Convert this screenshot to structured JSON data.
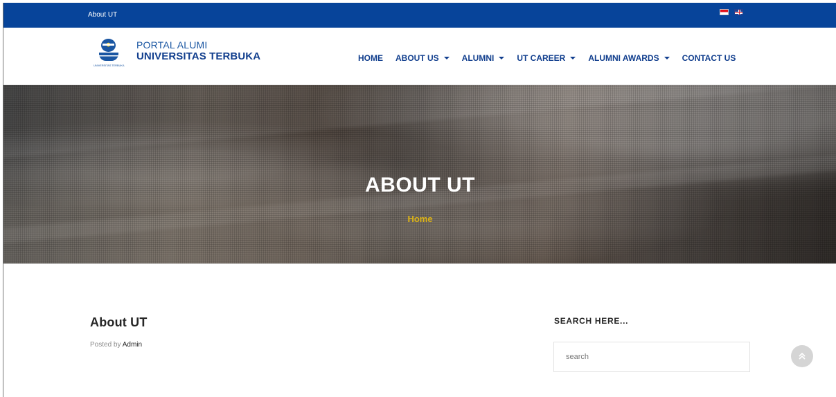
{
  "topbar": {
    "title": "About UT",
    "flags": [
      {
        "icon": "indonesia-flag-icon"
      },
      {
        "icon": "united-kingdom-flag-icon"
      }
    ]
  },
  "logo": {
    "line1": "PORTAL ALUMI",
    "line2": "UNIVERSITAS TERBUKA",
    "mark_text": "UNIVERSITAS TERBUKA"
  },
  "nav": {
    "items": [
      {
        "label": "HOME"
      },
      {
        "label": "ABOUT US"
      },
      {
        "label": "ALUMNI"
      },
      {
        "label": "UT CAREER"
      },
      {
        "label": "ALUMNI AWARDS"
      },
      {
        "label": "CONTACT US"
      }
    ]
  },
  "hero": {
    "title": "ABOUT UT",
    "breadcrumb": "Home"
  },
  "post": {
    "title": "About UT",
    "meta_prefix": "Posted by",
    "author": "Admin"
  },
  "sidebar": {
    "search_title": "SEARCH HERE...",
    "search_placeholder": "search"
  },
  "colors": {
    "topbar": "#07449a",
    "nav_text": "#123f8e",
    "breadcrumb": "#dcb315"
  }
}
